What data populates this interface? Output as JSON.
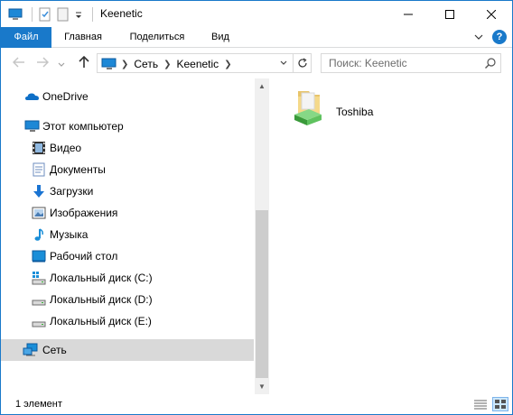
{
  "window": {
    "title": "Keenetic"
  },
  "ribbon": {
    "tabs": [
      "Файл",
      "Главная",
      "Поделиться",
      "Вид"
    ]
  },
  "address": {
    "crumbs": [
      "Сеть",
      "Keenetic"
    ]
  },
  "search": {
    "placeholder": "Поиск: Keenetic"
  },
  "navpane": {
    "onedrive": "OneDrive",
    "this_pc": "Этот компьютер",
    "items": [
      {
        "label": "Видео",
        "icon": "video-icon"
      },
      {
        "label": "Документы",
        "icon": "documents-icon"
      },
      {
        "label": "Загрузки",
        "icon": "downloads-icon"
      },
      {
        "label": "Изображения",
        "icon": "pictures-icon"
      },
      {
        "label": "Музыка",
        "icon": "music-icon"
      },
      {
        "label": "Рабочий стол",
        "icon": "desktop-icon"
      },
      {
        "label": "Локальный диск (C:)",
        "icon": "system-drive-icon"
      },
      {
        "label": "Локальный диск (D:)",
        "icon": "drive-icon"
      },
      {
        "label": "Локальный диск (E:)",
        "icon": "drive-icon"
      }
    ],
    "network": "Сеть"
  },
  "content": {
    "items": [
      {
        "name": "Toshiba",
        "icon": "shared-folder-icon"
      }
    ]
  },
  "status": {
    "count": "1 элемент"
  },
  "colors": {
    "accent": "#1979ca",
    "selected": "#d9d9d9"
  }
}
